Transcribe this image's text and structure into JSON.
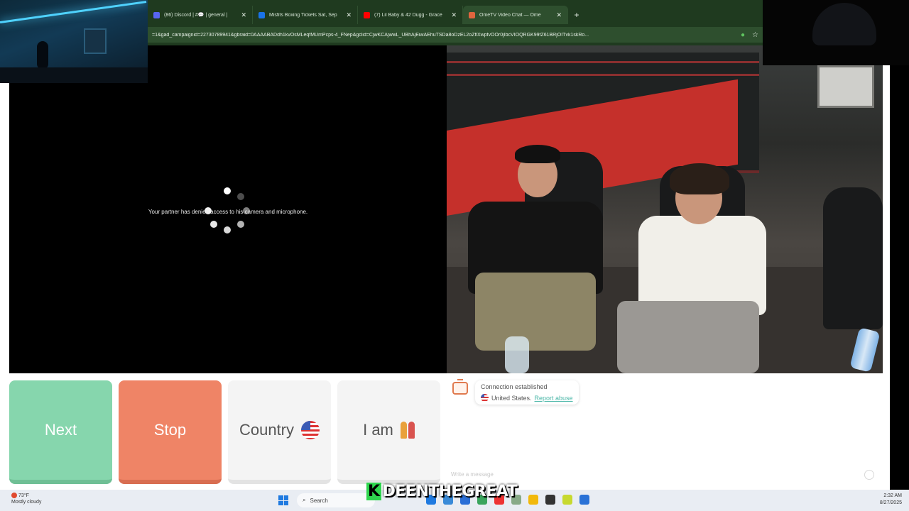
{
  "browser": {
    "tabs": [
      {
        "title": "(86) Discord | #💬 | general |",
        "fav_color": "#5865f2",
        "active": false
      },
      {
        "title": "Misfits Boxing Tickets Sat, Sep",
        "fav_color": "#1a73e8",
        "active": false
      },
      {
        "title": "(7) Lil Baby & 42 Dugg - Grace",
        "fav_color": "#ff0000",
        "active": false
      },
      {
        "title": "OmeTV Video Chat — Ome",
        "fav_color": "#e0653e",
        "active": true
      }
    ],
    "new_tab": "+",
    "url": "=1&gad_campaignid=22730789941&gbraid=0AAAABADdh1kvOsMLeqfMUmPcps-4_FNep&gclid=CjwKCAjwwL_UBhAjEiwAEhuTSDa8oDzEL2oZflXwpfvOOr0jIbcVIOQRGK99fZ61BRjOITvk1skRo..."
  },
  "partner": {
    "message": "Your partner has denied access to his camera and microphone."
  },
  "controls": {
    "next": "Next",
    "stop": "Stop",
    "country": "Country",
    "iam": "I am"
  },
  "chat": {
    "status": "Connection established",
    "country": "United States.",
    "report": "Report abuse",
    "placeholder": "Write a message"
  },
  "taskbar": {
    "weather_temp": "73°F",
    "weather_desc": "Mostly cloudy",
    "search": "Search",
    "time": "2:32 AM",
    "date": "8/27/2025"
  },
  "stream_overlay": {
    "name_k": "K",
    "name_rest": "DEENTHEGREAT"
  },
  "colors": {
    "next_green": "#86d6ad",
    "stop_orange": "#ef8466",
    "browser_green": "#1f3a1f"
  }
}
